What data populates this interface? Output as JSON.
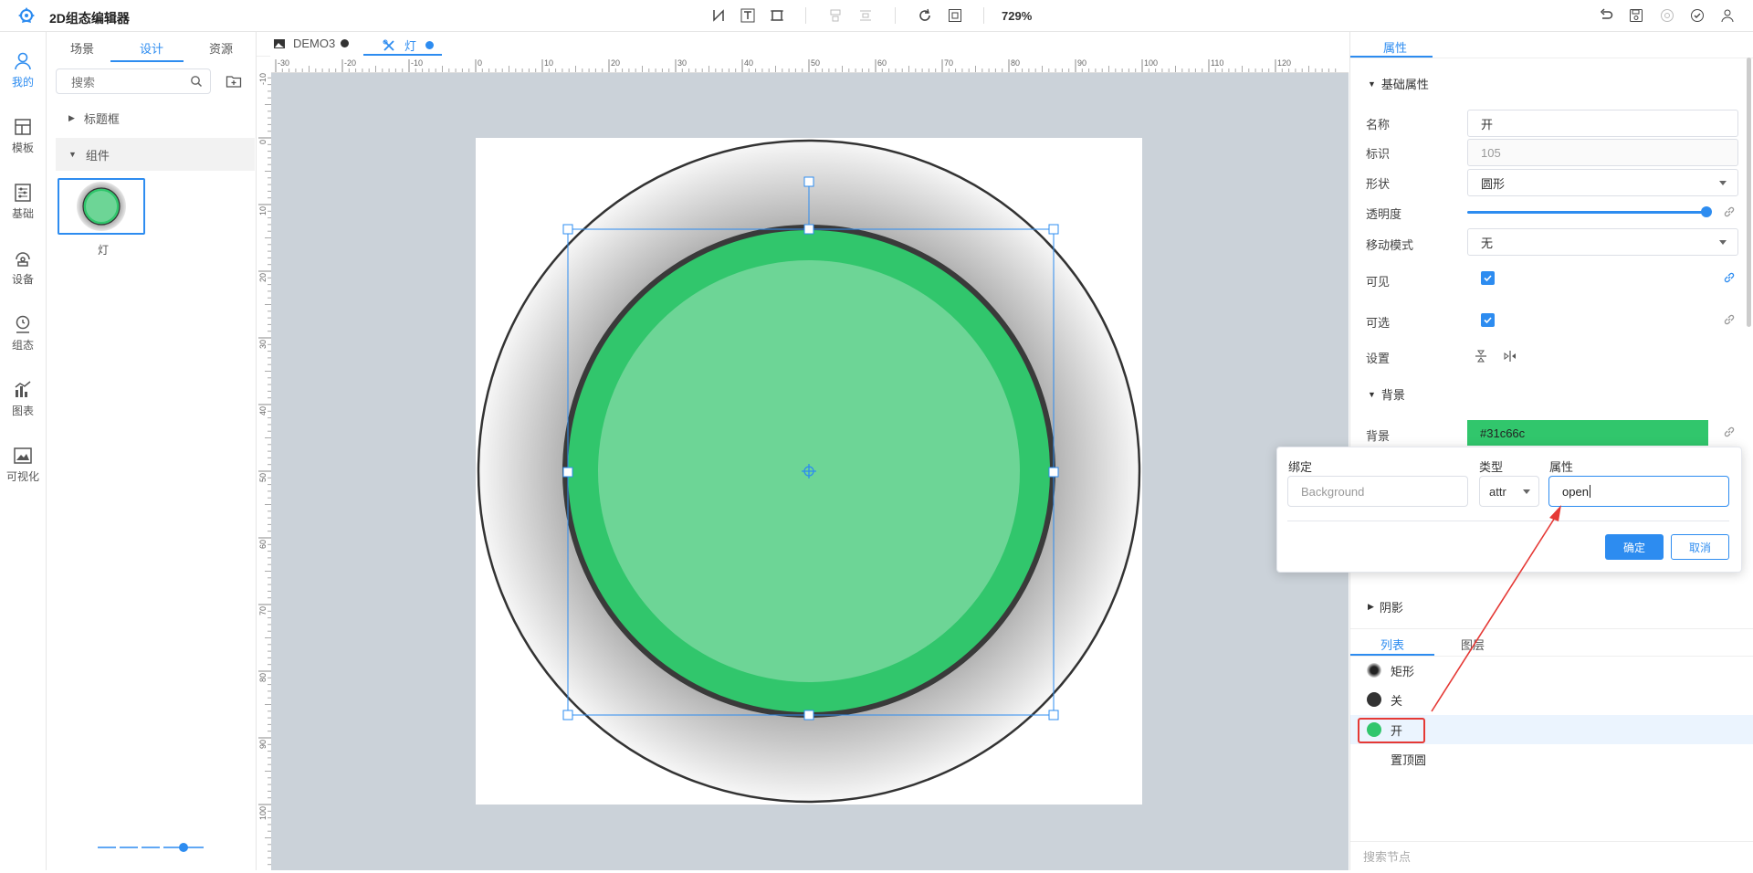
{
  "app": {
    "title": "2D组态编辑器"
  },
  "toolbar": {
    "zoom": "729%"
  },
  "rail": {
    "items": [
      {
        "label": "我的",
        "icon": "user-icon",
        "active": true
      },
      {
        "label": "模板",
        "icon": "template-icon"
      },
      {
        "label": "基础",
        "icon": "sliders-icon"
      },
      {
        "label": "设备",
        "icon": "device-icon"
      },
      {
        "label": "组态",
        "icon": "config-icon"
      },
      {
        "label": "图表",
        "icon": "chart-icon"
      },
      {
        "label": "可视化",
        "icon": "visual-icon"
      }
    ]
  },
  "left_panel": {
    "tabs": [
      "场景",
      "设计",
      "资源"
    ],
    "active_tab": "设计",
    "search_placeholder": "搜索",
    "tree": [
      {
        "label": "标题框",
        "expanded": false
      },
      {
        "label": "组件",
        "expanded": true
      }
    ],
    "component": {
      "label": "灯"
    }
  },
  "doc_tabs": [
    {
      "label": "DEMO3",
      "dot_color": "#333333"
    },
    {
      "label": "灯",
      "dot_color": "#2d8cf0",
      "active": true
    }
  ],
  "rulers": {
    "h_ticks": [
      "-30",
      "-20",
      "-10",
      "0",
      "10",
      "20",
      "30",
      "40",
      "50",
      "60",
      "70",
      "80",
      "90",
      "100",
      "110",
      "120"
    ],
    "v_ticks": [
      "-10",
      "0",
      "10",
      "20",
      "30",
      "40",
      "50",
      "60",
      "70",
      "80",
      "90",
      "100"
    ]
  },
  "canvas": {
    "outer_fill": "#cccccc",
    "ring_color": "#3a3a3a",
    "green_outer": "#31c66c",
    "green_inner": "#6dd596"
  },
  "props": {
    "tabs": [
      "属性"
    ],
    "section_basic": "基础属性",
    "name_label": "名称",
    "name_value": "开",
    "id_label": "标识",
    "id_value": "105",
    "shape_label": "形状",
    "shape_value": "圆形",
    "opacity_label": "透明度",
    "move_label": "移动模式",
    "move_value": "无",
    "visible_label": "可见",
    "selectable_label": "可选",
    "settings_label": "设置",
    "section_bg": "背景",
    "bg_label": "背景",
    "bg_value": "#31c66c",
    "section_shadow": "阴影"
  },
  "popup": {
    "bind_label": "绑定",
    "bind_placeholder": "Background",
    "type_label": "类型",
    "type_value": "attr",
    "attr_label": "属性",
    "attr_value": "open",
    "ok": "确定",
    "cancel": "取消"
  },
  "layers": {
    "tabs": [
      "列表",
      "图层"
    ],
    "items": [
      {
        "label": "矩形",
        "color": "#222222"
      },
      {
        "label": "关",
        "color": "#333333"
      },
      {
        "label": "开",
        "color": "#31c66c",
        "selected": true
      },
      {
        "label": "置顶圆"
      }
    ],
    "search_placeholder": "搜索节点"
  }
}
